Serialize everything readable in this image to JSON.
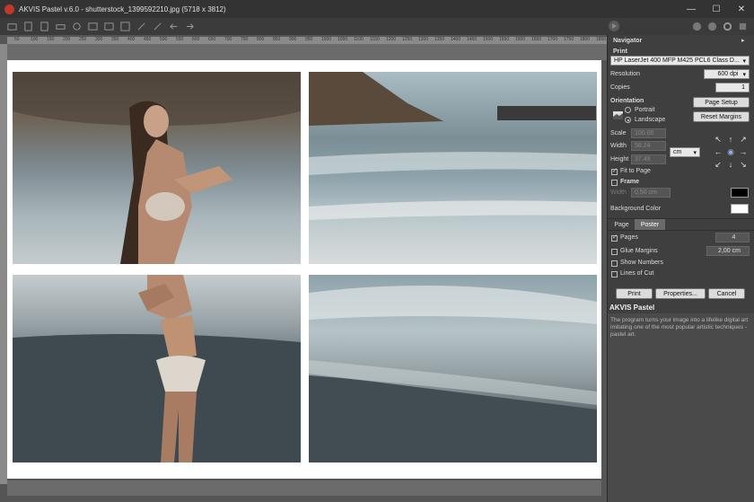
{
  "window": {
    "title": "AKVIS Pastel v.6.0 - shutterstock_1399592210.jpg (5718 x 3812)",
    "minimize": "—",
    "maximize": "☐",
    "close": "✕"
  },
  "ruler": {
    "ticks": [
      "50",
      "100",
      "150",
      "200",
      "250",
      "300",
      "350",
      "400",
      "450",
      "500",
      "550",
      "600",
      "650",
      "700",
      "750",
      "800",
      "850",
      "900",
      "950",
      "1000",
      "1050",
      "1100",
      "1150",
      "1200",
      "1250",
      "1300",
      "1350",
      "1400",
      "1450",
      "1500",
      "1550",
      "1600",
      "1650",
      "1700",
      "1750",
      "1800",
      "1850"
    ]
  },
  "panel": {
    "navigator": "Navigator",
    "print_head": "Print",
    "printer": "HP LaserJet 400 MFP M425 PCL6 Class D...",
    "resolution_label": "Resolution",
    "resolution_value": "600 dpi",
    "copies_label": "Copies",
    "copies_value": "1",
    "orientation_label": "Orientation",
    "portrait": "Portrait",
    "landscape": "Landscape",
    "page_setup": "Page Setup",
    "reset_margins": "Reset Margins",
    "scale_label": "Scale",
    "scale_value": "100.00",
    "width_label": "Width",
    "width_value": "56.24",
    "height_label": "Height",
    "height_value": "37.49",
    "unit": "cm",
    "fit_to_page": "Fit to Page",
    "frame": "Frame",
    "frame_width_label": "Width",
    "frame_width_value": "0,50 cm",
    "frame_color": "#000000",
    "bg_color_label": "Background Color",
    "bg_color": "#ffffff",
    "tab_page": "Page",
    "tab_poster": "Poster",
    "pages_label": "Pages",
    "pages_value": "4",
    "glue_margins_label": "Glue Margins",
    "glue_margins_value": "2,00 cm",
    "show_numbers": "Show Numbers",
    "lines_of_cut": "Lines of Cut",
    "print_btn": "Print",
    "properties_btn": "Properties...",
    "cancel_btn": "Cancel"
  },
  "info": {
    "title": "AKVIS Pastel",
    "text": "The program turns your image into a lifelike digital art imitating one of the most popular artistic techniques - pastel art."
  }
}
